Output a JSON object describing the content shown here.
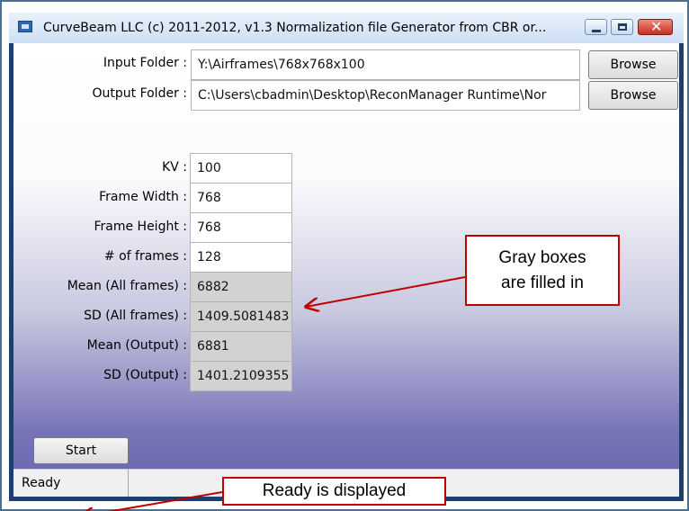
{
  "window": {
    "title": "CurveBeam LLC (c) 2011-2012, v1.3 Normalization file Generator from CBR or...",
    "minimize_icon": "minimize-icon",
    "maximize_icon": "maximize-icon",
    "close_icon": "close-icon",
    "app_icon": "app-window-icon"
  },
  "folders": {
    "input_label": "Input Folder :",
    "input_value": "Y:\\Airframes\\768x768x100",
    "output_label": "Output Folder :",
    "output_value": "C:\\Users\\cbadmin\\Desktop\\ReconManager Runtime\\Nor",
    "browse_label": "Browse"
  },
  "params": [
    {
      "label": "KV :",
      "value": "100",
      "readonly": false
    },
    {
      "label": "Frame Width :",
      "value": "768",
      "readonly": false
    },
    {
      "label": "Frame Height :",
      "value": "768",
      "readonly": false
    },
    {
      "label": "# of frames :",
      "value": "128",
      "readonly": false
    },
    {
      "label": "Mean (All frames) :",
      "value": "6882",
      "readonly": true
    },
    {
      "label": "SD (All frames) :",
      "value": "1409.5081483",
      "readonly": true
    },
    {
      "label": "Mean (Output) :",
      "value": "6881",
      "readonly": true
    },
    {
      "label": "SD (Output) :",
      "value": "1401.2109355",
      "readonly": true
    }
  ],
  "start_label": "Start",
  "status": {
    "text": "Ready"
  },
  "annotations": {
    "gray_boxes": "Gray boxes\nare filled in",
    "ready": "Ready is displayed",
    "color": "#c00000"
  }
}
